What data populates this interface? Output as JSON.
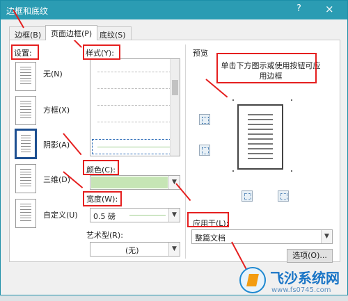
{
  "title": "边框和底纹",
  "help": "?",
  "close": "×",
  "tabs": [
    "边框(B)",
    "页面边框(P)",
    "底纹(S)"
  ],
  "settings": {
    "label": "设置:",
    "items": [
      "无(N)",
      "方框(X)",
      "阴影(A)",
      "三维(D)",
      "自定义(U)"
    ],
    "selected": "阴影(A)"
  },
  "style": {
    "label": "样式(Y):"
  },
  "color": {
    "label": "颜色(C):",
    "value_color": "#c6e5b5"
  },
  "width": {
    "label": "宽度(W):",
    "value": "0.5 磅"
  },
  "art": {
    "label": "艺术型(R):",
    "value": "(无)"
  },
  "preview": {
    "label": "预览",
    "hint": "单击下方图示或使用按钮可应用边框"
  },
  "apply": {
    "label": "应用于(L):",
    "value": "整篇文档"
  },
  "options_button": "选项(O)...",
  "watermark": {
    "name": "飞沙系统网",
    "url": "www.fs0745.com"
  },
  "accent": "#e51f1f",
  "titlebar_color": "#2b9cb3"
}
